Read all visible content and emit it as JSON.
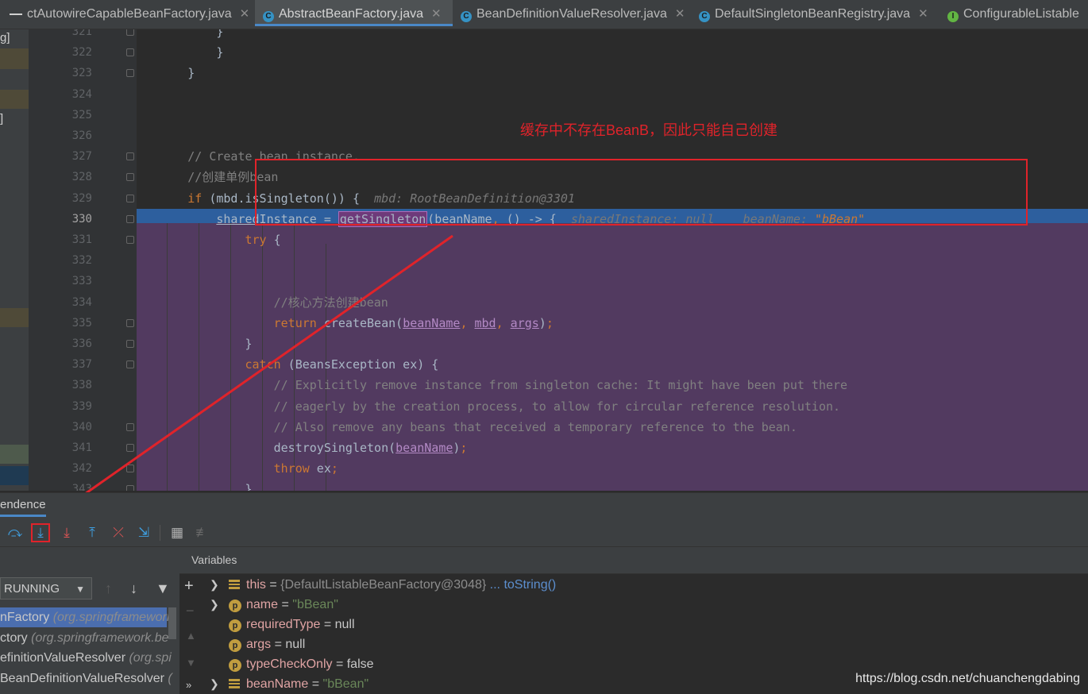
{
  "tabs": [
    {
      "label": "ctAutowireCapableBeanFactory.java",
      "icon": "class-icon",
      "active": false,
      "closable": true
    },
    {
      "label": "AbstractBeanFactory.java",
      "icon": "class-icon",
      "active": true,
      "closable": true
    },
    {
      "label": "BeanDefinitionValueResolver.java",
      "icon": "class-icon",
      "active": false,
      "closable": true
    },
    {
      "label": "DefaultSingletonBeanRegistry.java",
      "icon": "class-icon",
      "active": false,
      "closable": true
    },
    {
      "label": "ConfigurableListable",
      "icon": "interface-icon",
      "active": false,
      "closable": false
    }
  ],
  "left_strip": {
    "labels": [
      "g]",
      "]"
    ]
  },
  "annotation": "缓存中不存在BeanB，因此只能自己创建",
  "editor": {
    "current_line": "330",
    "lines": [
      {
        "no": "321",
        "html": "            }"
      },
      {
        "no": "322",
        "html": "            }"
      },
      {
        "no": "323",
        "html": "        }"
      },
      {
        "no": "324",
        "html": ""
      },
      {
        "no": "325",
        "html": ""
      },
      {
        "no": "326",
        "html": ""
      },
      {
        "no": "327",
        "html": "        <span class='cm'>// Create bean instance.</span>"
      },
      {
        "no": "328",
        "html": "        <span class='cm'>//创建单例bean</span>"
      },
      {
        "no": "329",
        "html": "        <span class='kw'>if</span> (mbd.isSingleton()) {  <span class='hint'>mbd: RootBeanDefinition@3301</span>"
      },
      {
        "no": "330",
        "html": "            <span class='var'>sharedInstance</span> = <span class='mcall'>getSingleton</span>(beanName<span class='kw'>,</span> () -> {  <span class='hint'>sharedInstance: null    beanName: <span class='hv'>\"bBean\"</span></span>"
      },
      {
        "no": "331",
        "html": "                <span class='kw'>try</span> {"
      },
      {
        "no": "332",
        "html": ""
      },
      {
        "no": "333",
        "html": ""
      },
      {
        "no": "334",
        "html": "                    <span class='cm'>//核心方法创建bean</span>"
      },
      {
        "no": "335",
        "html": "                    <span class='kw'>return</span> createBean(<span class='pv'>beanName</span><span class='kw'>,</span> <span class='pv'>mbd</span><span class='kw'>,</span> <span class='pv'>args</span>)<span class='kw'>;</span>"
      },
      {
        "no": "336",
        "html": "                }"
      },
      {
        "no": "337",
        "html": "                <span class='kw'>catch</span> (BeansException ex) {"
      },
      {
        "no": "338",
        "html": "                    <span class='cm'>// Explicitly remove instance from singleton cache: It might have been put there</span>"
      },
      {
        "no": "339",
        "html": "                    <span class='cm'>// eagerly by the creation process, to allow for circular reference resolution.</span>"
      },
      {
        "no": "340",
        "html": "                    <span class='cm'>// Also remove any beans that received a temporary reference to the bean.</span>"
      },
      {
        "no": "341",
        "html": "                    destroySingleton(<span class='pv'>beanName</span>)<span class='kw'>;</span>"
      },
      {
        "no": "342",
        "html": "                    <span class='kw'>throw</span> ex<span class='kw'>;</span>"
      },
      {
        "no": "343",
        "html": "                }"
      }
    ]
  },
  "debug": {
    "title": "endence",
    "toolbar": [
      {
        "name": "step-over-icon",
        "glyph": "⤼",
        "color": "#3f9fe0"
      },
      {
        "name": "step-into-icon",
        "glyph": "⤓",
        "color": "#3f9fe0",
        "highlight": true
      },
      {
        "name": "force-step-into-icon",
        "glyph": "⤓",
        "color": "#e05555"
      },
      {
        "name": "step-out-icon",
        "glyph": "⤒",
        "color": "#3f9fe0"
      },
      {
        "name": "drop-frame-icon",
        "glyph": "⤫",
        "color": "#e05555"
      },
      {
        "name": "run-to-cursor-icon",
        "glyph": "⇲",
        "color": "#3f9fe0"
      },
      {
        "name": "evaluate-expression-icon",
        "glyph": "▦",
        "color": "#b0b0b0"
      },
      {
        "name": "trace-stream-icon",
        "glyph": "≢",
        "color": "#6a6a6a"
      }
    ],
    "thread": "RUNNING",
    "frames": [
      {
        "name": "nFactory",
        "pkg": "(org.springframework",
        "selected": true
      },
      {
        "name": "ctory",
        "pkg": "(org.springframework.be",
        "selected": false
      },
      {
        "name": "efinitionValueResolver",
        "pkg": "(org.spi",
        "selected": false
      },
      {
        "name": " BeanDefinitionValueResolver",
        "pkg": "(",
        "selected": false
      }
    ],
    "variables_title": "Variables",
    "variables": [
      {
        "expandable": true,
        "kind": "field",
        "name": "this",
        "eq": " = ",
        "value": "{DefaultListableBeanFactory@3048}",
        "vclass": "vobj",
        "extra": " ... toString()"
      },
      {
        "expandable": true,
        "kind": "param",
        "name": "name",
        "eq": " = ",
        "value": "\"bBean\"",
        "vclass": "vstr",
        "extra": ""
      },
      {
        "expandable": false,
        "kind": "param",
        "name": "requiredType",
        "eq": " = ",
        "value": "null",
        "vclass": "vval",
        "extra": ""
      },
      {
        "expandable": false,
        "kind": "param",
        "name": "args",
        "eq": " = ",
        "value": "null",
        "vclass": "vval",
        "extra": ""
      },
      {
        "expandable": false,
        "kind": "param",
        "name": "typeCheckOnly",
        "eq": " = ",
        "value": "false",
        "vclass": "vval",
        "extra": ""
      },
      {
        "expandable": true,
        "kind": "field",
        "name": "beanName",
        "eq": " = ",
        "value": "\"bBean\"",
        "vclass": "vstr",
        "extra": ""
      }
    ]
  },
  "watermark": "https://blog.csdn.net/chuanchengdabing",
  "colors": {
    "highlight_line": "#2d5f9e",
    "lambda_band": "#523a60",
    "annotation": "#e0232a"
  }
}
